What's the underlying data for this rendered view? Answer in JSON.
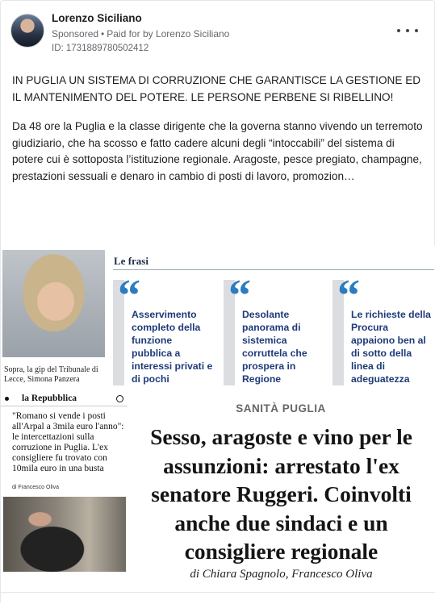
{
  "post": {
    "author": "Lorenzo Siciliano",
    "sponsored": "Sponsored",
    "separator": "•",
    "paid_for": "Paid for by Lorenzo Siciliano",
    "ad_id": "ID: 1731889780502412",
    "headline": "IN PUGLIA UN SISTEMA DI CORRUZIONE CHE GARANTISCE LA GESTIONE ED IL MANTENIMENTO DEL POTERE. LE PERSONE PERBENE SI RIBELLINO!",
    "body": "Da 48 ore la Puglia e la classe dirigente che la governa stanno vivendo un terremoto giudiziario, che ha scosso e fatto cadere alcuni degli “intoccabili” del sistema di potere cui è sottoposta l’istituzione regionale. Aragoste, pesce pregiato, champagne, prestazioni sessuali e denaro in cambio di posti di lavoro, promozion…",
    "icons": {
      "more": "more-options-icon",
      "avatar": "profile-avatar"
    }
  },
  "image": {
    "caption_gip": "Sopra, la gip del Tribunale di Lecce, Simona Panzera",
    "frasi_title": "Le frasi",
    "quotes": [
      {
        "mark": "“",
        "text": "Asservimento completo della funzione pubblica a interessi privati e di pochi"
      },
      {
        "mark": "“",
        "text": "Desolante panorama di sistemica corruttela che prospera in Regione"
      },
      {
        "mark": "“",
        "text": "Le richieste della Procura appaiono ben al di sotto della linea di adeguatezza"
      }
    ],
    "repubblica_logo": "la Repubblica",
    "repubblica_headline": "\"Romano si vende i posti all'Arpal a 3mila euro l'anno\": le intercettazioni sulla corruzione in Puglia. L'ex consigliere fu trovato con 10mila euro in una busta",
    "repubblica_author": "di Francesco Oliva",
    "section": "SANITÀ PUGLIA",
    "main_headline": "Sesso, aragoste e vino per le assunzioni: arrestato l'ex senatore Ruggeri. Coinvolti anche due sindaci e un consigliere regionale",
    "main_byline": "di Chiara Spagnolo, Francesco Oliva"
  }
}
